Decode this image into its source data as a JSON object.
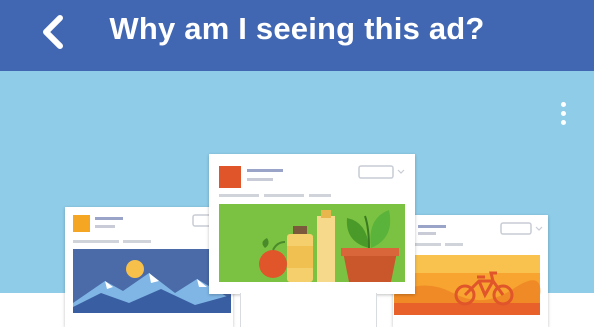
{
  "header": {
    "title": "Why am I seeing this ad?",
    "background": "#4267b2"
  },
  "hero": {
    "background": "#8fcce8"
  },
  "icons": {
    "back": "chevron-left-icon",
    "more": "more-vertical-icon"
  },
  "ad_cards": [
    {
      "position": "left",
      "image": "mountain-landscape",
      "logo_color": "#f5a623"
    },
    {
      "position": "center",
      "image": "groceries-and-plant",
      "logo_color": "#e0552a"
    },
    {
      "position": "right",
      "image": "bicycle-sunset",
      "logo_color": "#3b5998"
    }
  ]
}
